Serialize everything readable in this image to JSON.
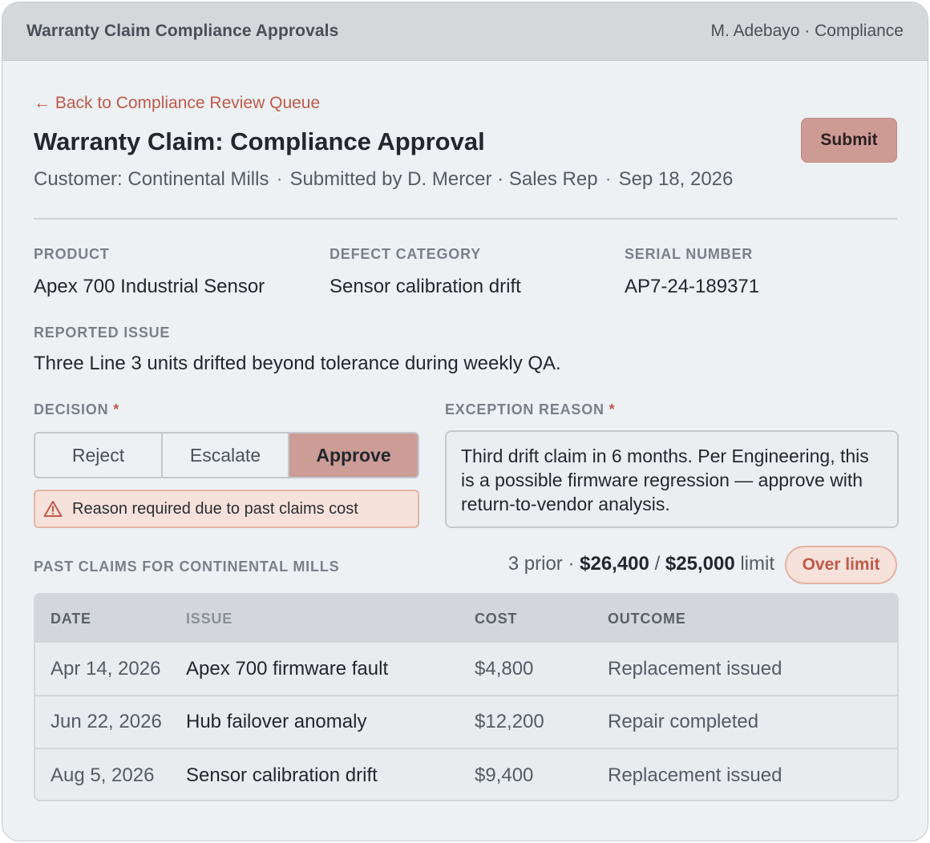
{
  "header": {
    "app_title": "Warranty Claim Compliance Approvals",
    "user": "M. Adebayo · Compliance"
  },
  "page": {
    "back_link": "← Back to Compliance Review Queue",
    "title": "Warranty Claim: Compliance Approval",
    "submit_label": "Submit",
    "meta": {
      "customer": "Customer: Continental Mills",
      "submitted_by": "Submitted by D. Mercer · Sales Rep",
      "date": "Sep 18, 2026",
      "separator": "·"
    }
  },
  "details": {
    "product": {
      "label": "PRODUCT",
      "value": "Apex 700 Industrial Sensor"
    },
    "defect_category": {
      "label": "DEFECT CATEGORY",
      "value": "Sensor calibration drift"
    },
    "serial_number": {
      "label": "SERIAL NUMBER",
      "value": "AP7-24-189371"
    },
    "reported_issue": {
      "label": "REPORTED ISSUE",
      "value": "Three Line 3 units drifted beyond tolerance during weekly QA."
    }
  },
  "decision": {
    "label": "DECISION",
    "required_mark": "*",
    "options": [
      "Reject",
      "Escalate",
      "Approve"
    ],
    "selected": "Approve",
    "warning": "Reason required due to past claims cost"
  },
  "exception_reason": {
    "label": "EXCEPTION REASON",
    "required_mark": "*",
    "value": "Third drift claim in 6 months. Per Engineering, this is a possible firmware regression — approve with return-to-vendor analysis."
  },
  "past_claims": {
    "label": "PAST CLAIMS FOR CONTINENTAL MILLS",
    "prior": "3 prior ·",
    "total": "$26,400",
    "slash": "/",
    "limit_amount": "$25,000",
    "limit_word": "limit",
    "badge": "Over limit",
    "columns": [
      "DATE",
      "ISSUE",
      "COST",
      "OUTCOME"
    ],
    "rows": [
      {
        "date": "Apr 14, 2026",
        "issue": "Apex 700 firmware fault",
        "cost": "$4,800",
        "outcome": "Replacement issued"
      },
      {
        "date": "Jun 22, 2026",
        "issue": "Hub failover anomaly",
        "cost": "$12,200",
        "outcome": "Repair completed"
      },
      {
        "date": "Aug 5, 2026",
        "issue": "Sensor calibration drift",
        "cost": "$9,400",
        "outcome": "Replacement issued"
      }
    ]
  },
  "colors": {
    "accent": "#c0594a",
    "selected_segment": "#cc9c96",
    "submit": "#cd9a94",
    "warning_bg": "#f6e2da"
  },
  "icons": {
    "warning": "warning-triangle-icon"
  }
}
